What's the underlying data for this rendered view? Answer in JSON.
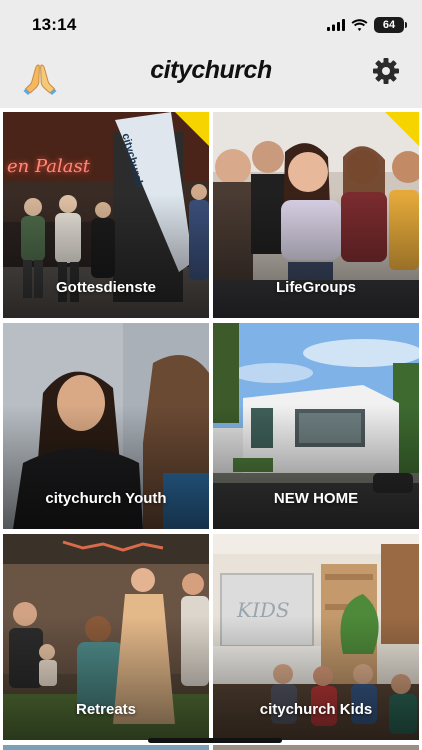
{
  "status_bar": {
    "time": "13:14",
    "battery": "64"
  },
  "header": {
    "title": "citychurch",
    "left_icon": "praying-hands-icon",
    "right_icon": "gear-icon"
  },
  "tiles": [
    {
      "label": "Gottesdienste",
      "banner_text": "citychurch",
      "sign_text": "en Palast",
      "badge_color": "#f6d400"
    },
    {
      "label": "LifeGroups",
      "badge_color": "#f6d400"
    },
    {
      "label": "citychurch Youth"
    },
    {
      "label": "NEW HOME"
    },
    {
      "label": "Retreats"
    },
    {
      "label": "citychurch Kids",
      "screen_text": "KIDS"
    }
  ],
  "colors": {
    "status_bg": "#ececec",
    "accent_yellow": "#f6d400",
    "label_text": "#ffffff"
  }
}
